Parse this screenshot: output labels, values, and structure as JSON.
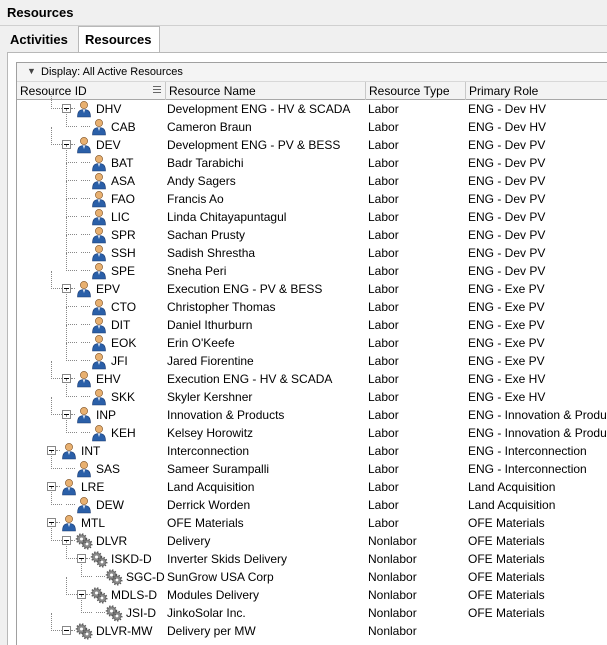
{
  "window": {
    "title": "Resources"
  },
  "tabs": [
    {
      "label": "Activities",
      "active": false
    },
    {
      "label": "Resources",
      "active": true
    }
  ],
  "display_filter": "Display: All Active Resources",
  "columns": [
    "Resource ID",
    "Resource Name",
    "Resource Type",
    "Primary Role"
  ],
  "colors": {
    "panel_bg": "#ffffff",
    "header_bg": "#f3f3f3",
    "labor_icon_skin": "#e8b070",
    "labor_icon_shirt": "#2a5fa8",
    "nonlabor_icon": "#8a8a8a"
  },
  "rows": [
    {
      "level": 1,
      "toggle": true,
      "icon": "person-icon",
      "id": "DHV",
      "name": "Development ENG - HV & SCADA",
      "type": "Labor",
      "role": "ENG - Dev HV"
    },
    {
      "level": 2,
      "toggle": false,
      "icon": "person-icon",
      "id": "CAB",
      "name": "Cameron Braun",
      "type": "Labor",
      "role": "ENG - Dev HV"
    },
    {
      "level": 1,
      "toggle": true,
      "icon": "person-icon",
      "id": "DEV",
      "name": "Development ENG - PV & BESS",
      "type": "Labor",
      "role": "ENG - Dev PV"
    },
    {
      "level": 2,
      "toggle": false,
      "icon": "person-icon",
      "id": "BAT",
      "name": "Badr Tarabichi",
      "type": "Labor",
      "role": "ENG - Dev PV"
    },
    {
      "level": 2,
      "toggle": false,
      "icon": "person-icon",
      "id": "ASA",
      "name": "Andy Sagers",
      "type": "Labor",
      "role": "ENG - Dev PV"
    },
    {
      "level": 2,
      "toggle": false,
      "icon": "person-icon",
      "id": "FAO",
      "name": "Francis Ao",
      "type": "Labor",
      "role": "ENG - Dev PV"
    },
    {
      "level": 2,
      "toggle": false,
      "icon": "person-icon",
      "id": "LIC",
      "name": "Linda Chitayapuntagul",
      "type": "Labor",
      "role": "ENG - Dev PV"
    },
    {
      "level": 2,
      "toggle": false,
      "icon": "person-icon",
      "id": "SPR",
      "name": "Sachan Prusty",
      "type": "Labor",
      "role": "ENG - Dev PV"
    },
    {
      "level": 2,
      "toggle": false,
      "icon": "person-icon",
      "id": "SSH",
      "name": "Sadish Shrestha",
      "type": "Labor",
      "role": "ENG - Dev PV"
    },
    {
      "level": 2,
      "toggle": false,
      "icon": "person-icon",
      "id": "SPE",
      "name": "Sneha Peri",
      "type": "Labor",
      "role": "ENG - Dev PV"
    },
    {
      "level": 1,
      "toggle": true,
      "icon": "person-icon",
      "id": "EPV",
      "name": "Execution ENG - PV & BESS",
      "type": "Labor",
      "role": "ENG - Exe PV"
    },
    {
      "level": 2,
      "toggle": false,
      "icon": "person-icon",
      "id": "CTO",
      "name": "Christopher Thomas",
      "type": "Labor",
      "role": "ENG - Exe PV"
    },
    {
      "level": 2,
      "toggle": false,
      "icon": "person-icon",
      "id": "DIT",
      "name": "Daniel Ithurburn",
      "type": "Labor",
      "role": "ENG - Exe PV"
    },
    {
      "level": 2,
      "toggle": false,
      "icon": "person-icon",
      "id": "EOK",
      "name": "Erin O'Keefe",
      "type": "Labor",
      "role": "ENG - Exe PV"
    },
    {
      "level": 2,
      "toggle": false,
      "icon": "person-icon",
      "id": "JFI",
      "name": "Jared Fiorentine",
      "type": "Labor",
      "role": "ENG - Exe PV"
    },
    {
      "level": 1,
      "toggle": true,
      "icon": "person-icon",
      "id": "EHV",
      "name": "Execution ENG - HV & SCADA",
      "type": "Labor",
      "role": "ENG - Exe HV"
    },
    {
      "level": 2,
      "toggle": false,
      "icon": "person-icon",
      "id": "SKK",
      "name": "Skyler Kershner",
      "type": "Labor",
      "role": "ENG - Exe HV"
    },
    {
      "level": 1,
      "toggle": true,
      "icon": "person-icon",
      "id": "INP",
      "name": "Innovation & Products",
      "type": "Labor",
      "role": "ENG - Innovation & Products"
    },
    {
      "level": 2,
      "toggle": false,
      "icon": "person-icon",
      "id": "KEH",
      "name": "Kelsey Horowitz",
      "type": "Labor",
      "role": "ENG - Innovation & Products"
    },
    {
      "level": 0,
      "toggle": true,
      "icon": "person-icon",
      "id": "INT",
      "name": "Interconnection",
      "type": "Labor",
      "role": "ENG - Interconnection"
    },
    {
      "level": 1,
      "toggle": false,
      "icon": "person-icon",
      "id": "SAS",
      "name": "Sameer Surampalli",
      "type": "Labor",
      "role": "ENG - Interconnection"
    },
    {
      "level": 0,
      "toggle": true,
      "icon": "person-icon",
      "id": "LRE",
      "name": "Land Acquisition",
      "type": "Labor",
      "role": "Land Acquisition"
    },
    {
      "level": 1,
      "toggle": false,
      "icon": "person-icon",
      "id": "DEW",
      "name": "Derrick Worden",
      "type": "Labor",
      "role": "Land Acquisition"
    },
    {
      "level": 0,
      "toggle": true,
      "icon": "person-icon",
      "id": "MTL",
      "name": "OFE Materials",
      "type": "Labor",
      "role": "OFE Materials"
    },
    {
      "level": 1,
      "toggle": true,
      "icon": "gears-icon",
      "id": "DLVR",
      "name": "Delivery",
      "type": "Nonlabor",
      "role": "OFE Materials"
    },
    {
      "level": 2,
      "toggle": true,
      "icon": "gears-icon",
      "id": "ISKD-D",
      "name": "Inverter Skids Delivery",
      "type": "Nonlabor",
      "role": "OFE Materials"
    },
    {
      "level": 3,
      "toggle": false,
      "icon": "gears-icon",
      "id": "SGC-D",
      "name": "SunGrow USA Corp",
      "type": "Nonlabor",
      "role": "OFE Materials"
    },
    {
      "level": 2,
      "toggle": true,
      "icon": "gears-icon",
      "id": "MDLS-D",
      "name": "Modules Delivery",
      "type": "Nonlabor",
      "role": "OFE Materials"
    },
    {
      "level": 3,
      "toggle": false,
      "icon": "gears-icon",
      "id": "JSI-D",
      "name": "JinkoSolar Inc.",
      "type": "Nonlabor",
      "role": "OFE Materials"
    },
    {
      "level": 1,
      "toggle": true,
      "icon": "gears-icon",
      "id": "DLVR-MW",
      "name": "Delivery per MW",
      "type": "Nonlabor",
      "role": ""
    }
  ]
}
